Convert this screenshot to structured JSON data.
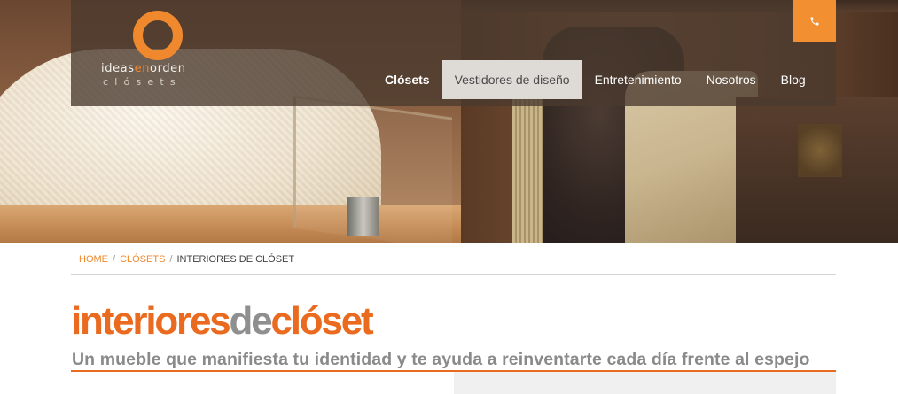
{
  "logo": {
    "line1_pre": "ideas",
    "line1_mid": "en",
    "line1_post": "orden",
    "line2": "clósets"
  },
  "nav": {
    "items": [
      {
        "label": "Clósets",
        "bold": true,
        "active": false
      },
      {
        "label": "Vestidores de diseño",
        "bold": false,
        "active": true
      },
      {
        "label": "Entretenimiento",
        "bold": false,
        "active": false
      },
      {
        "label": "Nosotros",
        "bold": false,
        "active": false
      },
      {
        "label": "Blog",
        "bold": false,
        "active": false
      }
    ]
  },
  "phone_button": {
    "icon": "phone-icon"
  },
  "breadcrumb": {
    "home": "HOME",
    "sep": "/",
    "closets": "CLÓSETS",
    "current": "INTERIORES DE CLÓSET"
  },
  "title": {
    "part1": "interiores",
    "part2": "de",
    "part3": "clóset"
  },
  "subtitle": "Un mueble que manifiesta tu identidad y te ayuda a reinventarte cada día frente al espejo",
  "colors": {
    "accent": "#f0892e",
    "title_orange": "#ea6a1f",
    "title_gray": "#8f8f8f",
    "header_overlay": "#4a3a2e"
  }
}
